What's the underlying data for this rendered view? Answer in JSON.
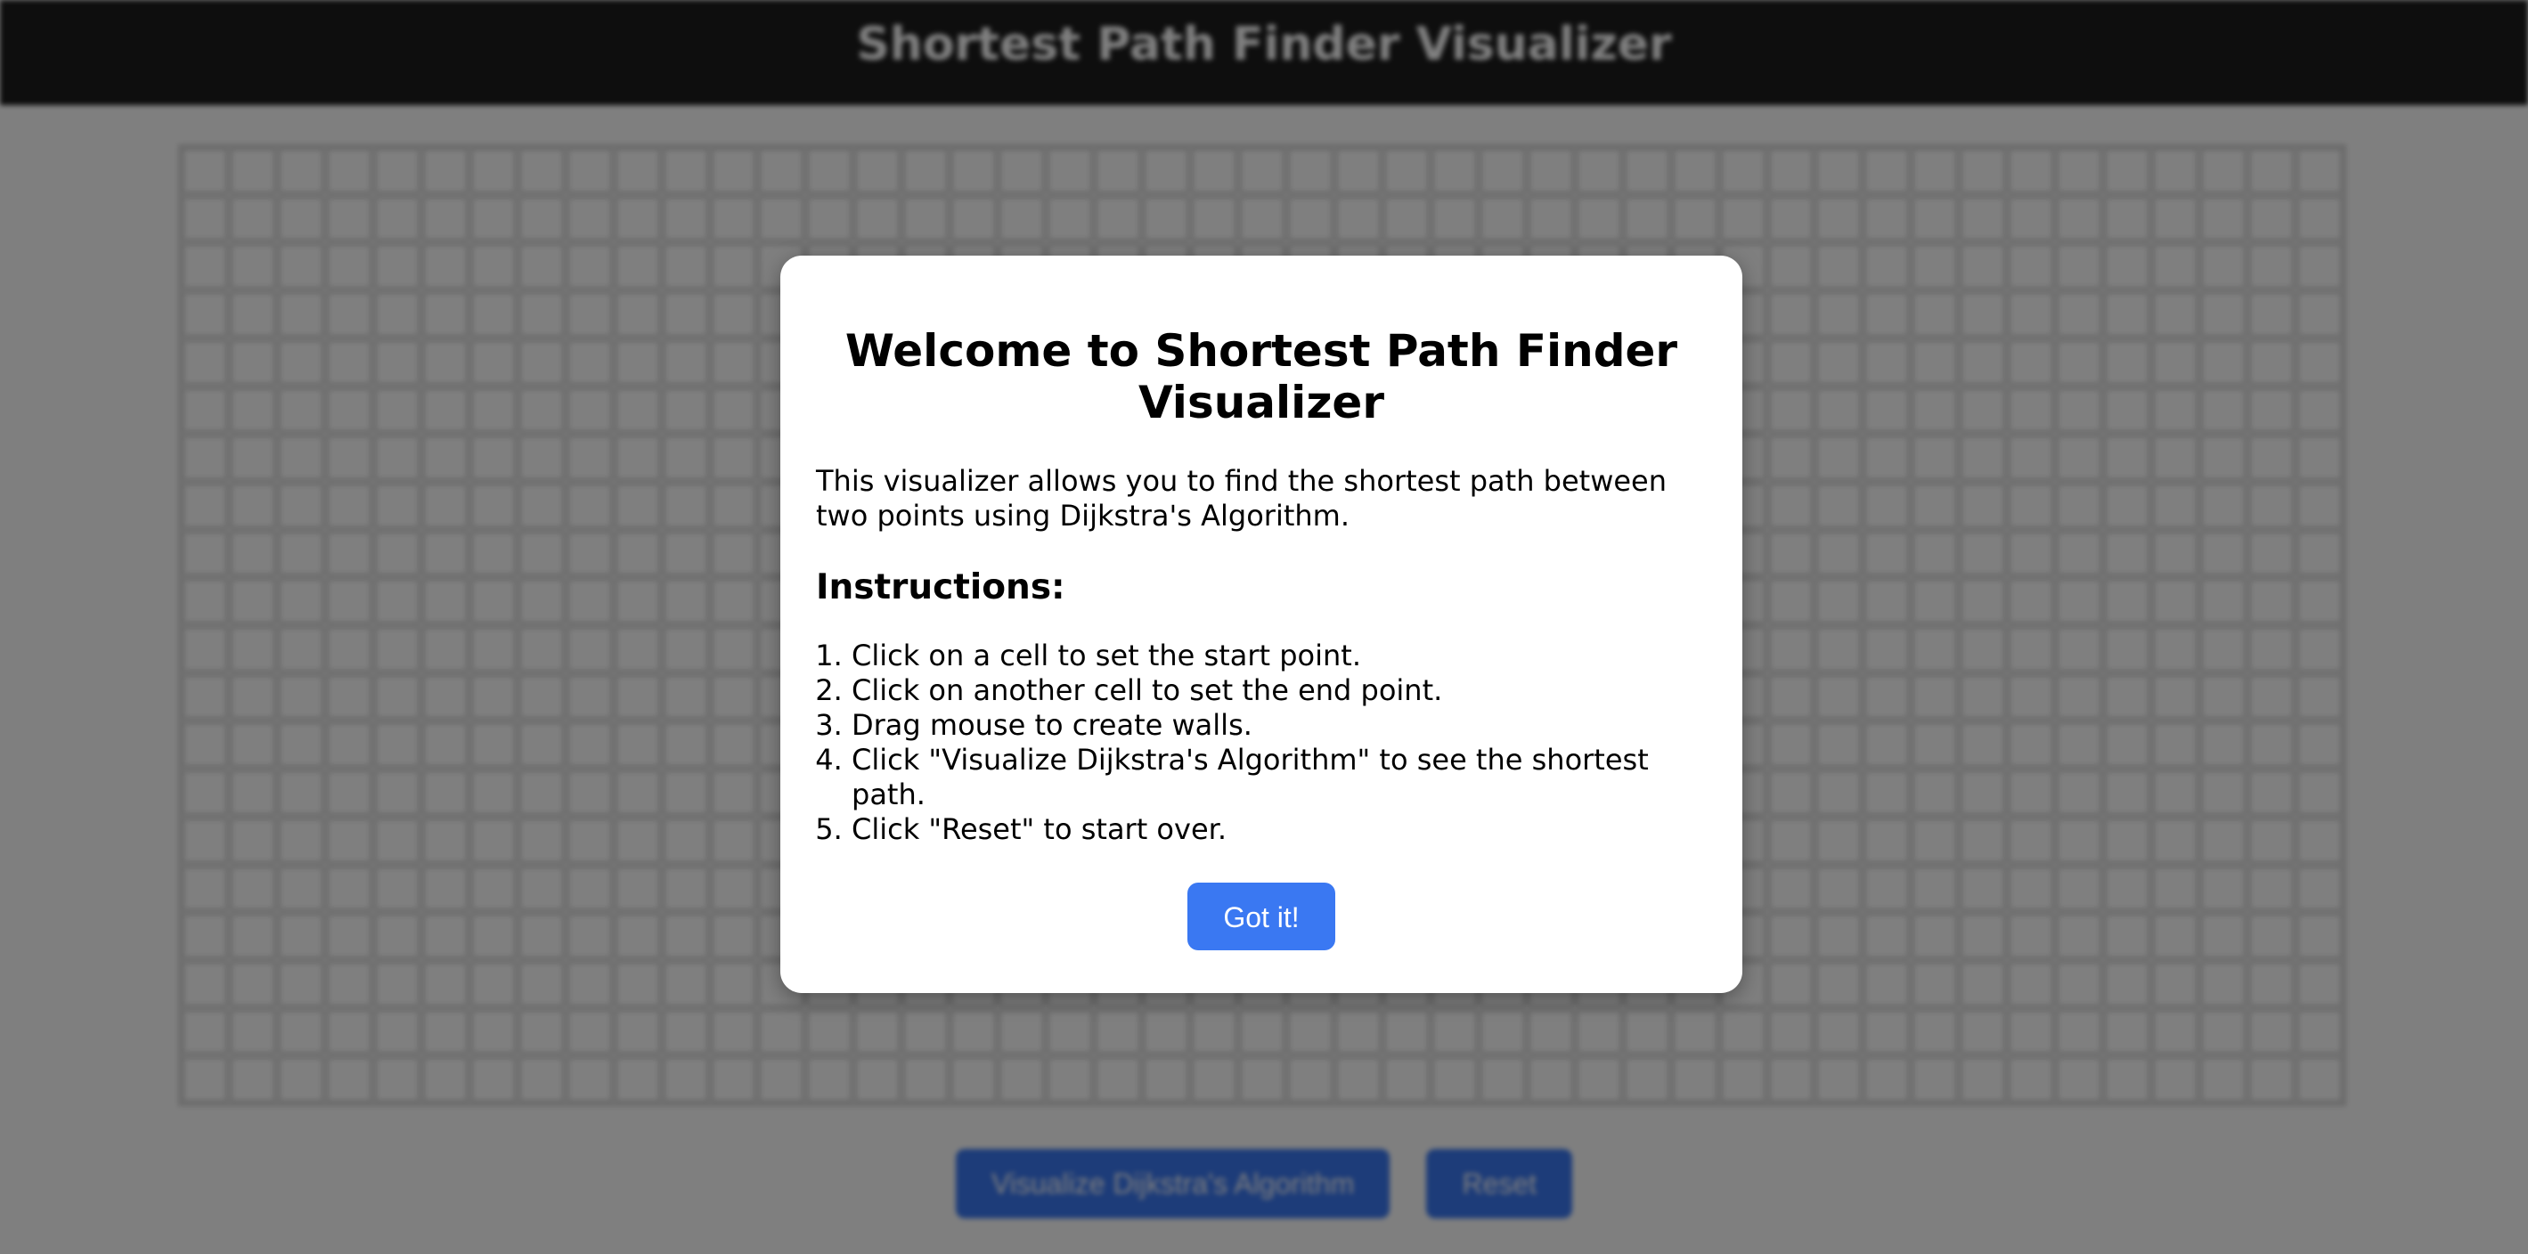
{
  "app": {
    "title": "Shortest Path Finder Visualizer",
    "grid": {
      "rows": 20,
      "columns": 45
    },
    "controls": {
      "visualize_label": "Visualize Dijkstra's Algorithm",
      "reset_label": "Reset"
    }
  },
  "modal": {
    "title": "Welcome to Shortest Path Finder Visualizer",
    "description": "This visualizer allows you to find the shortest path between two points using Dijkstra's Algorithm.",
    "instructions_heading": "Instructions:",
    "instructions": [
      "Click on a cell to set the start point.",
      "Click on another cell to set the end point.",
      "Drag mouse to create walls.",
      "Click \"Visualize Dijkstra's Algorithm\" to see the shortest path.",
      "Click \"Reset\" to start over."
    ],
    "button_label": "Got it!"
  },
  "colors": {
    "header_background": "#1c1c1c",
    "accent": "#3a78f2",
    "overlay": "rgba(0,0,0,0.5)",
    "grid_line": "#cfcfcf"
  }
}
